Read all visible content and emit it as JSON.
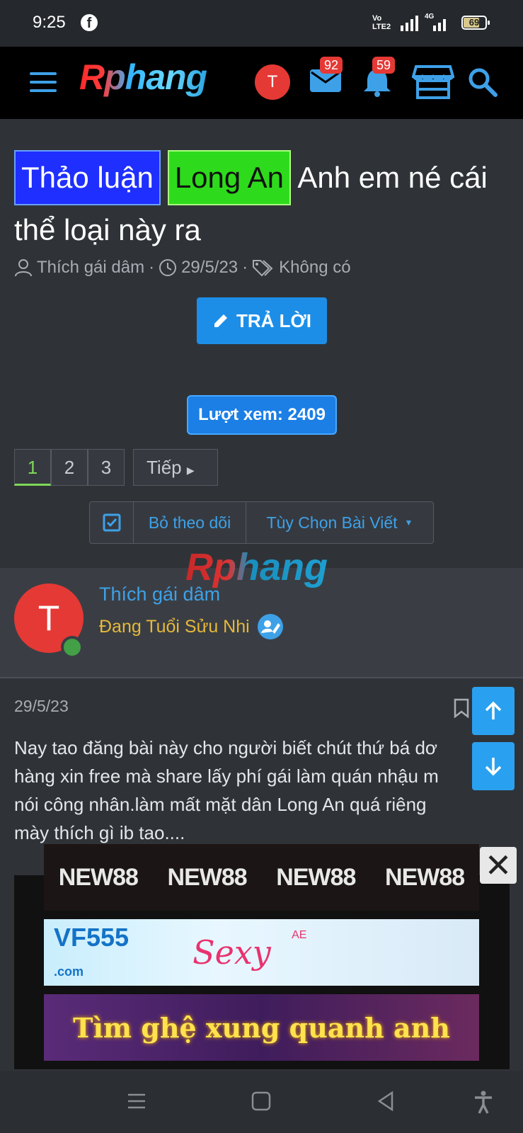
{
  "status": {
    "time": "9:25",
    "network_label": "Vo LTE2",
    "network_type": "4G",
    "battery": "69"
  },
  "header": {
    "logo": "Rphang",
    "avatar_letter": "T",
    "messages_count": "92",
    "alerts_count": "59",
    "accent_color": "#3ea1e8"
  },
  "thread": {
    "prefix_1": "Thảo luận",
    "prefix_2": "Long An",
    "title": "Anh em né cái thể loại này ra",
    "author": "Thích gái dâm",
    "date": "29/5/23",
    "tags": "Không có",
    "reply_label": "TRẢ LỜI",
    "views_label": "Lượt xem: 2409"
  },
  "pagination": {
    "pages": [
      "1",
      "2",
      "3"
    ],
    "current": "1",
    "next_label": "Tiếp"
  },
  "actions": {
    "unfollow_label": "Bỏ theo dõi",
    "options_label": "Tùy Chọn Bài Viết"
  },
  "post": {
    "watermark": "Rphang",
    "avatar_letter": "T",
    "username": "Thích gái dâm",
    "rank": "Đang Tuổi Sửu Nhi",
    "date": "29/5/23",
    "lines": [
      "Nay tao đăng bài này cho người biết chút thứ bá dơ",
      "hàng xin free mà share lấy phí gái làm quán nhậu m",
      "nói công nhân.làm mất mặt dân Long An quá riêng",
      "mày thích gì ib tao...."
    ]
  },
  "ads": {
    "ad1_brand": "NEW88",
    "ad2_brand": "VF555",
    "ad2_domain": ".com",
    "ad2_partner": "Sexy",
    "ad2_partner_tag": "AE",
    "ad3_text": "Tìm ghệ xung quanh anh",
    "close_symbol": "✕"
  }
}
